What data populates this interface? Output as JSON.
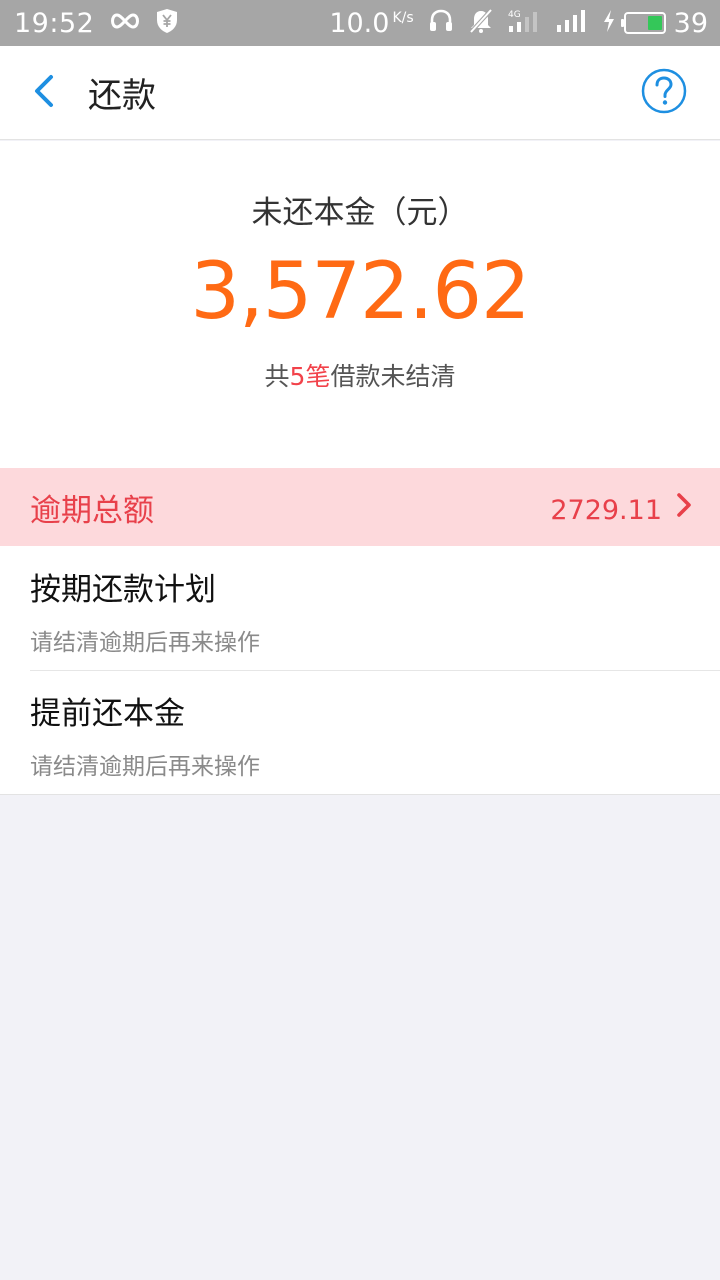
{
  "status_bar": {
    "time": "19:52",
    "net_speed": "10.0",
    "net_speed_unit": "K/s",
    "battery_level": "39",
    "icons": [
      "infinity-icon",
      "shield-yen-icon",
      "headset-icon",
      "mute-bell-icon",
      "signal-4g-icon",
      "signal-icon",
      "charging-icon",
      "battery-icon"
    ]
  },
  "nav": {
    "back_icon": "chevron-left-icon",
    "title": "还款",
    "help_icon": "help-circle-icon"
  },
  "summary": {
    "label": "未还本金（元）",
    "amount": "3,572.62",
    "count_prefix": "共",
    "count_value": "5笔",
    "count_suffix": "借款未结清"
  },
  "overdue": {
    "label": "逾期总额",
    "amount": "2729.11",
    "chevron_icon": "chevron-right-icon"
  },
  "list": {
    "items": [
      {
        "title": "按期还款计划",
        "subtitle": "请结清逾期后再来操作"
      },
      {
        "title": "提前还本金",
        "subtitle": "请结清逾期后再来操作"
      }
    ]
  },
  "colors": {
    "accent_blue": "#1e8fe1",
    "amount_orange": "#ff6a14",
    "overdue_red": "#e8404a",
    "overdue_bg": "#fdd9dc",
    "status_bar": "#a6a6a6",
    "page_bg": "#f2f2f7"
  }
}
